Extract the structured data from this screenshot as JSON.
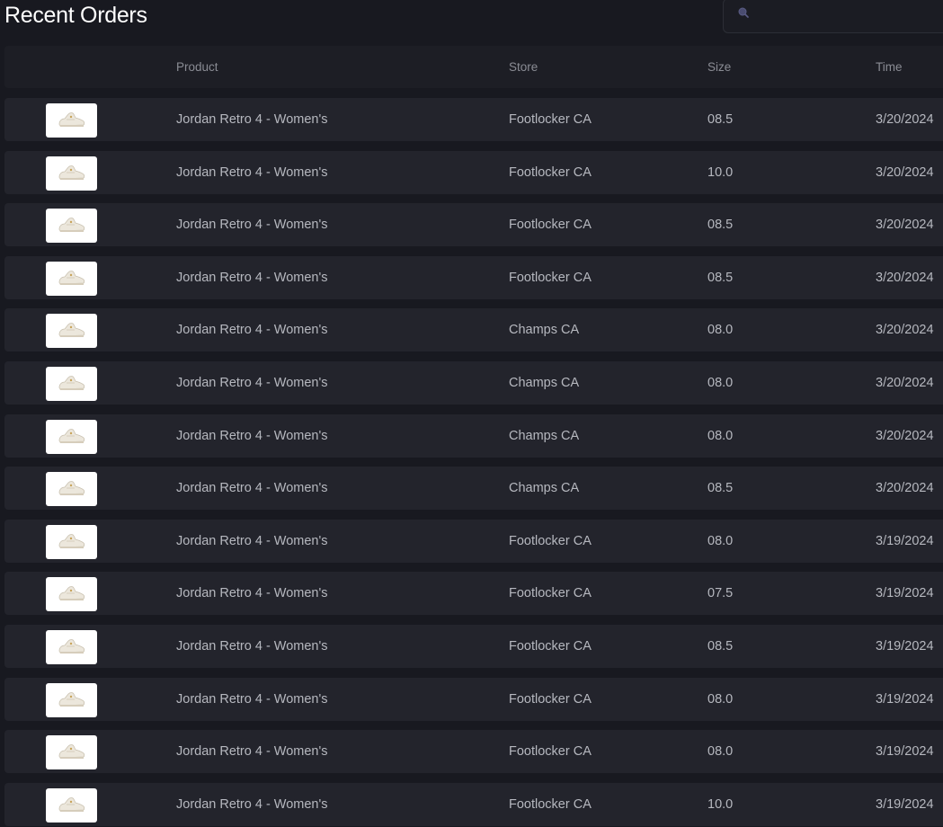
{
  "page": {
    "title": "Recent Orders"
  },
  "search": {
    "value": "",
    "placeholder": ""
  },
  "table": {
    "columns": {
      "image": "",
      "product": "Product",
      "store": "Store",
      "size": "Size",
      "time": "Time"
    },
    "rows": [
      {
        "product": "Jordan Retro 4 - Women's",
        "store": "Footlocker CA",
        "size": "08.5",
        "time": "3/20/2024"
      },
      {
        "product": "Jordan Retro 4 - Women's",
        "store": "Footlocker CA",
        "size": "10.0",
        "time": "3/20/2024"
      },
      {
        "product": "Jordan Retro 4 - Women's",
        "store": "Footlocker CA",
        "size": "08.5",
        "time": "3/20/2024"
      },
      {
        "product": "Jordan Retro 4 - Women's",
        "store": "Footlocker CA",
        "size": "08.5",
        "time": "3/20/2024"
      },
      {
        "product": "Jordan Retro 4 - Women's",
        "store": "Champs CA",
        "size": "08.0",
        "time": "3/20/2024"
      },
      {
        "product": "Jordan Retro 4 - Women's",
        "store": "Champs CA",
        "size": "08.0",
        "time": "3/20/2024"
      },
      {
        "product": "Jordan Retro 4 - Women's",
        "store": "Champs CA",
        "size": "08.0",
        "time": "3/20/2024"
      },
      {
        "product": "Jordan Retro 4 - Women's",
        "store": "Champs CA",
        "size": "08.5",
        "time": "3/20/2024"
      },
      {
        "product": "Jordan Retro 4 - Women's",
        "store": "Footlocker CA",
        "size": "08.0",
        "time": "3/19/2024"
      },
      {
        "product": "Jordan Retro 4 - Women's",
        "store": "Footlocker CA",
        "size": "07.5",
        "time": "3/19/2024"
      },
      {
        "product": "Jordan Retro 4 - Women's",
        "store": "Footlocker CA",
        "size": "08.5",
        "time": "3/19/2024"
      },
      {
        "product": "Jordan Retro 4 - Women's",
        "store": "Footlocker CA",
        "size": "08.0",
        "time": "3/19/2024"
      },
      {
        "product": "Jordan Retro 4 - Women's",
        "store": "Footlocker CA",
        "size": "08.0",
        "time": "3/19/2024"
      },
      {
        "product": "Jordan Retro 4 - Women's",
        "store": "Footlocker CA",
        "size": "10.0",
        "time": "3/19/2024"
      }
    ]
  },
  "icons": {
    "search": "search-icon",
    "product_image": "sneaker-thumbnail"
  },
  "colors": {
    "background": "#181920",
    "row_background": "#23242c",
    "header_background": "#1d1e25",
    "title_text": "#ffffff",
    "cell_text": "#b6b8bf",
    "header_text": "#8a8c94"
  }
}
